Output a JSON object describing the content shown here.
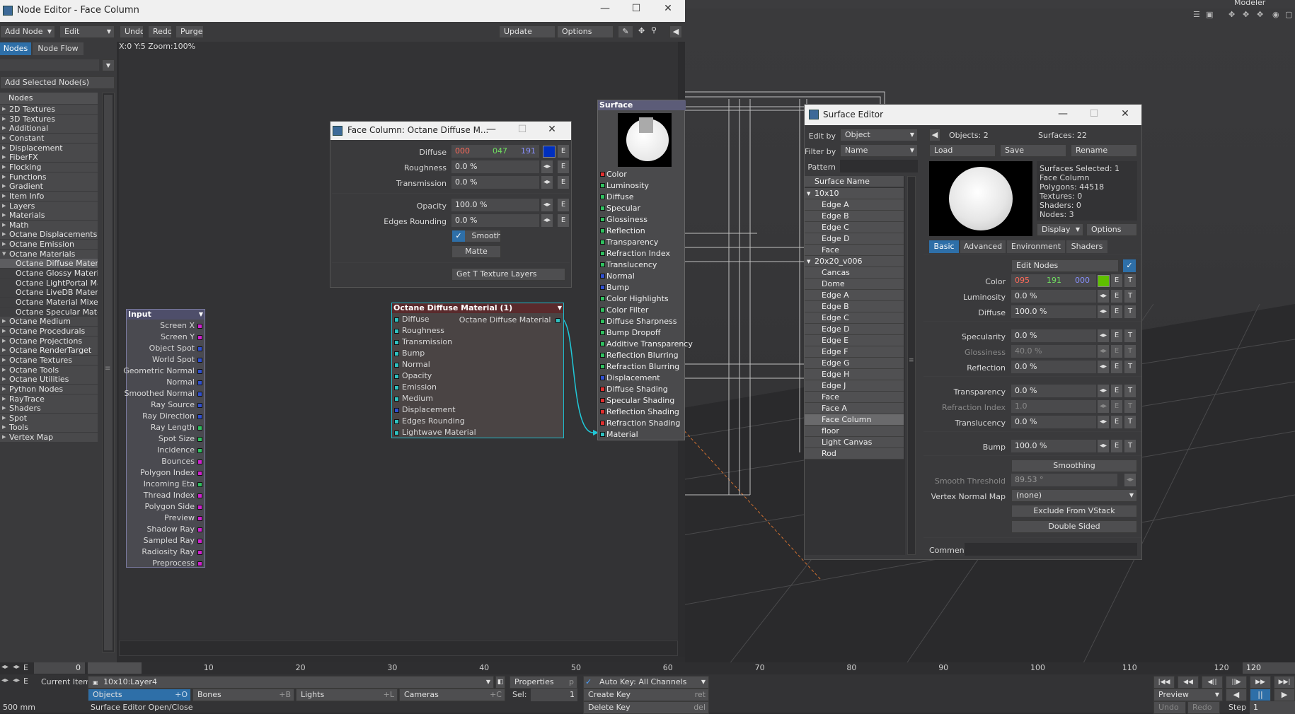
{
  "top_right": {
    "modeler": "Modeler"
  },
  "node_editor": {
    "title": "Node Editor - Face Column",
    "add_node": "Add Node",
    "edit": "Edit",
    "undo": "Undo",
    "redo": "Redo",
    "purge": "Purge",
    "update": "Update",
    "options": "Options",
    "tab_nodes": "Nodes",
    "tab_node_flow": "Node Flow",
    "add_selected": "Add Selected Node(s)",
    "nodes_header": "Nodes",
    "status": "X:0 Y:5 Zoom:100%",
    "categories": [
      {
        "label": "2D Textures"
      },
      {
        "label": "3D Textures"
      },
      {
        "label": "Additional"
      },
      {
        "label": "Constant"
      },
      {
        "label": "Displacement"
      },
      {
        "label": "FiberFX"
      },
      {
        "label": "Flocking"
      },
      {
        "label": "Functions"
      },
      {
        "label": "Gradient"
      },
      {
        "label": "Item Info"
      },
      {
        "label": "Layers"
      },
      {
        "label": "Materials"
      },
      {
        "label": "Math"
      },
      {
        "label": "Octane Displacements"
      },
      {
        "label": "Octane Emission"
      },
      {
        "label": "Octane Materials"
      },
      {
        "label": "Octane Diffuse Material"
      },
      {
        "label": "Octane Glossy Material"
      },
      {
        "label": "Octane LightPortal Mate"
      },
      {
        "label": "Octane LiveDB Material"
      },
      {
        "label": "Octane Material Mixer"
      },
      {
        "label": "Octane Specular Materia"
      },
      {
        "label": "Octane Medium"
      },
      {
        "label": "Octane Procedurals"
      },
      {
        "label": "Octane Projections"
      },
      {
        "label": "Octane RenderTarget"
      },
      {
        "label": "Octane Textures"
      },
      {
        "label": "Octane Tools"
      },
      {
        "label": "Octane Utilities"
      },
      {
        "label": "Python Nodes"
      },
      {
        "label": "RayTrace"
      },
      {
        "label": "Shaders"
      },
      {
        "label": "Spot"
      },
      {
        "label": "Tools"
      },
      {
        "label": "Vertex Map"
      }
    ]
  },
  "input_node": {
    "title": "Input",
    "outputs": [
      {
        "label": "Screen X",
        "color": "#d020d0"
      },
      {
        "label": "Screen Y",
        "color": "#d020d0"
      },
      {
        "label": "Object Spot",
        "color": "#3050d0"
      },
      {
        "label": "World Spot",
        "color": "#3050d0"
      },
      {
        "label": "Geometric Normal",
        "color": "#3050d0"
      },
      {
        "label": "Normal",
        "color": "#3050d0"
      },
      {
        "label": "Smoothed Normal",
        "color": "#3050d0"
      },
      {
        "label": "Ray Source",
        "color": "#3050d0"
      },
      {
        "label": "Ray Direction",
        "color": "#3050d0"
      },
      {
        "label": "Ray Length",
        "color": "#30c060"
      },
      {
        "label": "Spot Size",
        "color": "#30c060"
      },
      {
        "label": "Incidence",
        "color": "#30c060"
      },
      {
        "label": "Bounces",
        "color": "#d020d0"
      },
      {
        "label": "Polygon Index",
        "color": "#d020d0"
      },
      {
        "label": "Incoming Eta",
        "color": "#30c060"
      },
      {
        "label": "Thread Index",
        "color": "#d020d0"
      },
      {
        "label": "Polygon Side",
        "color": "#d020d0"
      },
      {
        "label": "Preview",
        "color": "#d020d0"
      },
      {
        "label": "Shadow Ray",
        "color": "#d020d0"
      },
      {
        "label": "Sampled Ray",
        "color": "#d020d0"
      },
      {
        "label": "Radiosity Ray",
        "color": "#d020d0"
      },
      {
        "label": "Preprocess",
        "color": "#d020d0"
      }
    ]
  },
  "octane_node": {
    "title": "Octane Diffuse Material (1)",
    "output": "Octane Diffuse Material",
    "inputs": [
      {
        "label": "Diffuse",
        "color": "#30c0c0"
      },
      {
        "label": "Roughness",
        "color": "#30c0c0"
      },
      {
        "label": "Transmission",
        "color": "#30c0c0"
      },
      {
        "label": "Bump",
        "color": "#30c0c0"
      },
      {
        "label": "Normal",
        "color": "#30c0c0"
      },
      {
        "label": "Opacity",
        "color": "#30c0c0"
      },
      {
        "label": "Emission",
        "color": "#30c0c0"
      },
      {
        "label": "Medium",
        "color": "#30c0c0"
      },
      {
        "label": "Displacement",
        "color": "#3050d0"
      },
      {
        "label": "Edges Rounding",
        "color": "#30c0c0"
      },
      {
        "label": "Lightwave Material",
        "color": "#30c0c0"
      }
    ]
  },
  "surface_node": {
    "title": "Surface",
    "inputs": [
      {
        "label": "Color",
        "color": "#e03030"
      },
      {
        "label": "Luminosity",
        "color": "#30c060"
      },
      {
        "label": "Diffuse",
        "color": "#30c060"
      },
      {
        "label": "Specular",
        "color": "#30c060"
      },
      {
        "label": "Glossiness",
        "color": "#30c060"
      },
      {
        "label": "Reflection",
        "color": "#30c060"
      },
      {
        "label": "Transparency",
        "color": "#30c060"
      },
      {
        "label": "Refraction Index",
        "color": "#30c060"
      },
      {
        "label": "Translucency",
        "color": "#30c060"
      },
      {
        "label": "Normal",
        "color": "#3050d0"
      },
      {
        "label": "Bump",
        "color": "#3050d0"
      },
      {
        "label": "Color Highlights",
        "color": "#30c060"
      },
      {
        "label": "Color Filter",
        "color": "#30c060"
      },
      {
        "label": "Diffuse Sharpness",
        "color": "#30c060"
      },
      {
        "label": "Bump Dropoff",
        "color": "#30c060"
      },
      {
        "label": "Additive Transparency",
        "color": "#30c060"
      },
      {
        "label": "Reflection Blurring",
        "color": "#30c060"
      },
      {
        "label": "Refraction Blurring",
        "color": "#30c060"
      },
      {
        "label": "Displacement",
        "color": "#3050d0"
      },
      {
        "label": "Diffuse Shading",
        "color": "#e03030"
      },
      {
        "label": "Specular Shading",
        "color": "#e03030"
      },
      {
        "label": "Reflection Shading",
        "color": "#e03030"
      },
      {
        "label": "Refraction Shading",
        "color": "#e03030"
      },
      {
        "label": "Material",
        "color": "#30c0c0"
      }
    ]
  },
  "octane_panel": {
    "title": "Face Column: Octane Diffuse M...",
    "diffuse_label": "Diffuse",
    "diffuse_r": "000",
    "diffuse_g": "047",
    "diffuse_b": "191",
    "diffuse_color": "#002fbf",
    "roughness_label": "Roughness",
    "roughness": "0.0 %",
    "transmission_label": "Transmission",
    "transmission": "0.0 %",
    "opacity_label": "Opacity",
    "opacity": "100.0 %",
    "edges_label": "Edges Rounding",
    "edges": "0.0 %",
    "smooth": "Smooth",
    "matte": "Matte",
    "get_layers": "Get T Texture Layers",
    "e": "E"
  },
  "surface_editor": {
    "title": "Surface Editor",
    "edit_by_label": "Edit by",
    "edit_by": "Object",
    "filter_by_label": "Filter by",
    "filter_by": "Name",
    "pattern_label": "Pattern",
    "objects": "Objects: 2",
    "surfaces": "Surfaces: 22",
    "load": "Load",
    "save": "Save",
    "rename": "Rename",
    "list_header": "Surface Name",
    "groups": [
      {
        "name": "10x10",
        "items": [
          "Edge A",
          "Edge B",
          "Edge C",
          "Edge D",
          "Face"
        ]
      },
      {
        "name": "20x20_v006",
        "items": [
          "Cancas",
          "Dome",
          "Edge A",
          "Edge B",
          "Edge C",
          "Edge D",
          "Edge E",
          "Edge F",
          "Edge G",
          "Edge H",
          "Edge J",
          "Face",
          "Face A",
          "Face Column",
          "floor",
          "Light Canvas",
          "Rod"
        ]
      }
    ],
    "info": [
      "Surfaces Selected: 1",
      "Face Column",
      "Polygons: 44518",
      "Textures: 0",
      "Shaders: 0",
      "Nodes: 3"
    ],
    "display": "Display",
    "options": "Options",
    "tabs": [
      "Basic",
      "Advanced",
      "Environment",
      "Shaders"
    ],
    "edit_nodes": "Edit Nodes",
    "color_label": "Color",
    "color_r": "095",
    "color_g": "191",
    "color_b": "000",
    "color_swatch": "#5fbf00",
    "luminosity_label": "Luminosity",
    "luminosity": "0.0 %",
    "diffuse_label": "Diffuse",
    "diffuse": "100.0 %",
    "specularity_label": "Specularity",
    "specularity": "0.0 %",
    "glossiness_label": "Glossiness",
    "glossiness": "40.0 %",
    "reflection_label": "Reflection",
    "reflection": "0.0 %",
    "transparency_label": "Transparency",
    "transparency": "0.0 %",
    "refraction_label": "Refraction Index",
    "refraction": "1.0",
    "translucency_label": "Translucency",
    "translucency": "0.0 %",
    "bump_label": "Bump",
    "bump": "100.0 %",
    "smoothing": "Smoothing",
    "smooth_threshold_label": "Smooth Threshold",
    "smooth_threshold": "89.53 °",
    "vertex_map_label": "Vertex Normal Map",
    "vertex_map": "(none)",
    "exclude": "Exclude From VStack",
    "double_sided": "Double Sided",
    "comment_label": "Comment",
    "e": "E",
    "t": "T"
  },
  "timeline": {
    "start": "0",
    "ticks": [
      "0",
      "10",
      "20",
      "30",
      "40",
      "50",
      "60",
      "70",
      "80",
      "90",
      "100",
      "110",
      "120"
    ],
    "end": "120",
    "current_item_label": "Current Item",
    "current_item": "10x10:Layer4",
    "properties": "Properties",
    "properties_key": "p",
    "auto_key": "Auto Key: All Channels",
    "objects": "Objects",
    "objects_key": "+O",
    "bones": "Bones",
    "bones_key": "+B",
    "lights": "Lights",
    "lights_key": "+L",
    "cameras": "Cameras",
    "cameras_key": "+C",
    "sel_label": "Sel:",
    "sel": "1",
    "create_key": "Create Key",
    "create_key_sc": "ret",
    "delete_key": "Delete Key",
    "delete_key_sc": "del",
    "grid": "500 mm",
    "status": "Surface Editor Open/Close",
    "preview": "Preview",
    "undo": "Undo",
    "redo": "Redo",
    "step_label": "Step",
    "step": "1",
    "e": "E"
  }
}
